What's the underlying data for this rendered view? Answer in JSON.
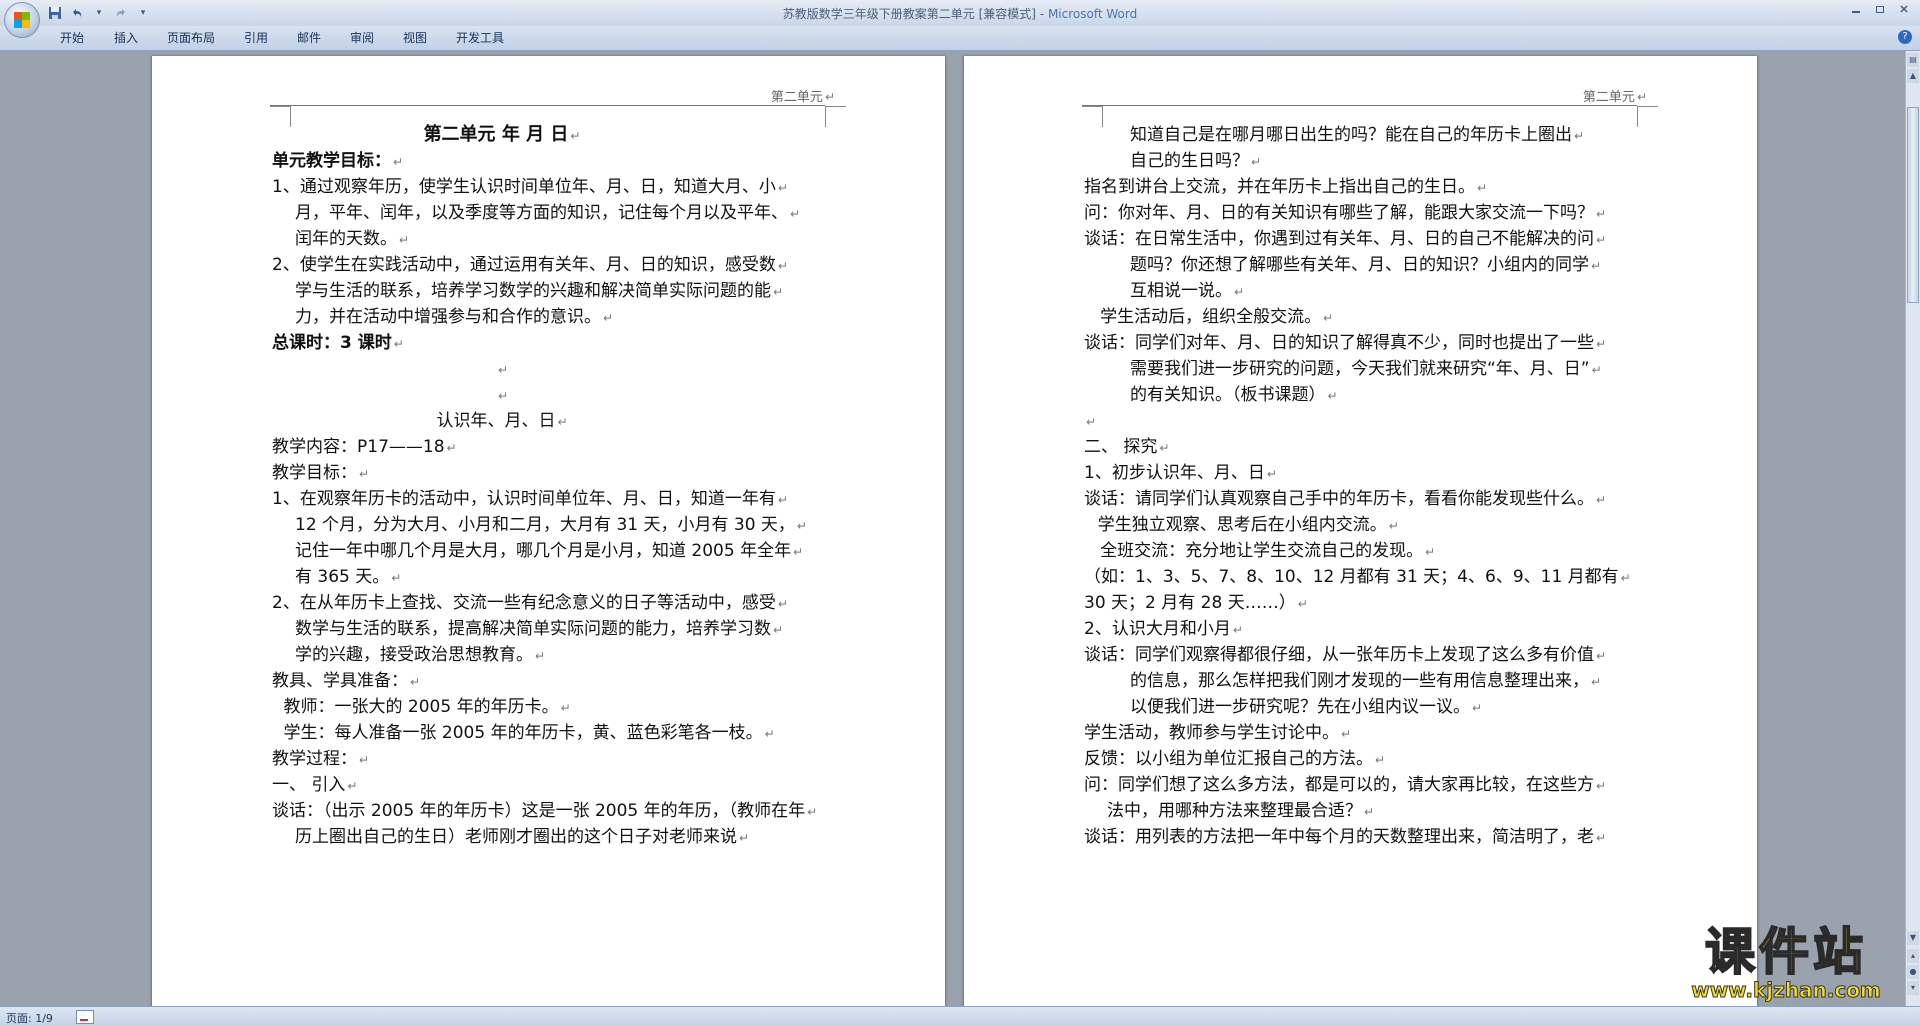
{
  "window": {
    "title": "苏教版数学三年级下册教案第二单元 [兼容模式]",
    "app_name": "Microsoft Word"
  },
  "quick_access": [
    {
      "icon": "save-icon",
      "label": "Save"
    },
    {
      "icon": "undo-icon",
      "label": "Undo"
    },
    {
      "icon": "redo-icon",
      "label": "Redo"
    },
    {
      "icon": "customize-icon",
      "label": "Customize"
    }
  ],
  "ribbon": {
    "tabs": [
      "开始",
      "插入",
      "页面布局",
      "引用",
      "邮件",
      "审阅",
      "视图",
      "开发工具"
    ]
  },
  "pages": {
    "left": {
      "header": "第二单元",
      "lines": [
        {
          "text": "第二单元        年  月  日",
          "bold": true,
          "title": true
        },
        {
          "text": "单元教学目标：",
          "bold": true
        },
        {
          "text": "1、通过观察年历，使学生认识时间单位年、月、日，知道大月、小"
        },
        {
          "text": "月，平年、闰年，以及季度等方面的知识，记住每个月以及平年、",
          "indent": 1
        },
        {
          "text": "闰年的天数。",
          "indent": 1
        },
        {
          "text": "2、使学生在实践活动中，通过运用有关年、月、日的知识，感受数"
        },
        {
          "text": "学与生活的联系，培养学习数学的兴趣和解决简单实际问题的能",
          "indent": 1
        },
        {
          "text": "力，并在活动中增强参与和合作的意识。",
          "indent": 1
        },
        {
          "text": "总课时：3 课时",
          "bold": true
        },
        {
          "text": "",
          "center": true
        },
        {
          "text": "",
          "center": true
        },
        {
          "text": "认识年、月、日",
          "center": true
        },
        {
          "text": "教学内容：P17——18"
        },
        {
          "text": "教学目标："
        },
        {
          "text": "1、在观察年历卡的活动中，认识时间单位年、月、日，知道一年有"
        },
        {
          "text": "12 个月，分为大月、小月和二月，大月有 31 天，小月有 30 天，",
          "indent": 1
        },
        {
          "text": "记住一年中哪几个月是大月，哪几个月是小月，知道 2005 年全年",
          "indent": 1
        },
        {
          "text": "有 365 天。",
          "indent": 1
        },
        {
          "text": "2、在从年历卡上查找、交流一些有纪念意义的日子等活动中，感受"
        },
        {
          "text": "数学与生活的联系，提高解决简单实际问题的能力，培养学习数",
          "indent": 1
        },
        {
          "text": "学的兴趣，接受政治思想教育。",
          "indent": 1
        },
        {
          "text": "教具、学具准备："
        },
        {
          "text": "教师：一张大的 2005 年的年历卡。",
          "indent": 0.5
        },
        {
          "text": "学生：每人准备一张 2005 年的年历卡，黄、蓝色彩笔各一枝。",
          "indent": 0.5
        },
        {
          "text": "教学过程："
        },
        {
          "text": "一、    引入"
        },
        {
          "text": "谈话：（出示 2005 年的年历卡）这是一张 2005 年的年历，（教师在年"
        },
        {
          "text": "历上圈出自己的生日）老师刚才圈出的这个日子对老师来说",
          "indent": 1
        }
      ]
    },
    "right": {
      "header": "第二单元",
      "lines": [
        {
          "text": "知道自己是在哪月哪日出生的吗？能在自己的年历卡上圈出",
          "indent": 2
        },
        {
          "text": "自己的生日吗？",
          "indent": 2
        },
        {
          "text": "指名到讲台上交流，并在年历卡上指出自己的生日。"
        },
        {
          "text": "问：你对年、月、日的有关知识有哪些了解，能跟大家交流一下吗？"
        },
        {
          "text": "谈话：在日常生活中，你遇到过有关年、月、日的自己不能解决的问"
        },
        {
          "text": "题吗？你还想了解哪些有关年、月、日的知识？小组内的同学",
          "indent": 2
        },
        {
          "text": "互相说一说。",
          "indent": 2
        },
        {
          "text": "学生活动后，组织全般交流。",
          "indent": 0.7
        },
        {
          "text": "谈话：同学们对年、月、日的知识了解得真不少，同时也提出了一些"
        },
        {
          "text": "需要我们进一步研究的问题，今天我们就来研究“年、月、日”",
          "indent": 2
        },
        {
          "text": "的有关知识。（板书课题）",
          "indent": 2
        },
        {
          "text": ""
        },
        {
          "text": "二、    探究"
        },
        {
          "text": "1、初步认识年、月、日"
        },
        {
          "text": "谈话：请同学们认真观察自己手中的年历卡，看看你能发现些什么。"
        },
        {
          "text": "学生独立观察、思考后在小组内交流。",
          "indent": 0.6
        },
        {
          "text": "全班交流：充分地让学生交流自己的发现。",
          "indent": 0.7
        },
        {
          "text": "（如：1、3、5、7、8、10、12 月都有 31 天；4、6、9、11 月都有"
        },
        {
          "text": "30 天；2 月有 28 天……）"
        },
        {
          "text": "2、认识大月和小月"
        },
        {
          "text": "谈话：同学们观察得都很仔细，从一张年历卡上发现了这么多有价值"
        },
        {
          "text": "的信息，那么怎样把我们刚才发现的一些有用信息整理出来，",
          "indent": 2
        },
        {
          "text": "以便我们进一步研究呢？先在小组内议一议。",
          "indent": 2
        },
        {
          "text": "学生活动，教师参与学生讨论中。"
        },
        {
          "text": "反馈：以小组为单位汇报自己的方法。"
        },
        {
          "text": "问：同学们想了这么多方法，都是可以的，请大家再比较，在这些方"
        },
        {
          "text": "法中，用哪种方法来整理最合适？",
          "indent": 1
        },
        {
          "text": "谈话：用列表的方法把一年中每个月的天数整理出来，简洁明了，老"
        }
      ]
    }
  },
  "status": {
    "page_indicator": "页面: 1/9"
  },
  "watermark": {
    "logo_text": "课件站",
    "url": "www.kjzhan.com"
  },
  "colors": {
    "workspace": "#9aa3ad",
    "ribbon": "#c2d1e6",
    "app_name": "#4a72b8",
    "watermark": "#f7de1b"
  }
}
